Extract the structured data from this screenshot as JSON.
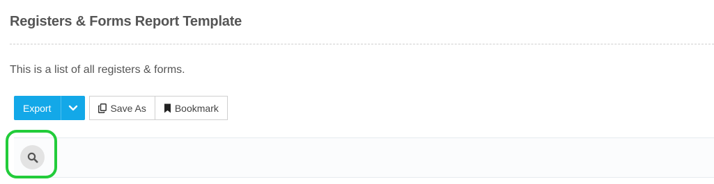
{
  "header": {
    "title": "Registers & Forms Report Template"
  },
  "description": "This is a list of all registers & forms.",
  "toolbar": {
    "export_label": "Export",
    "save_as_label": "Save As",
    "bookmark_label": "Bookmark"
  },
  "icons": {
    "export_dropdown": "chevron-down-icon",
    "save_as": "copy-icon",
    "bookmark": "bookmark-icon",
    "search": "search-icon"
  },
  "colors": {
    "accent": "#13a8e8",
    "highlight": "#22cc3a"
  }
}
